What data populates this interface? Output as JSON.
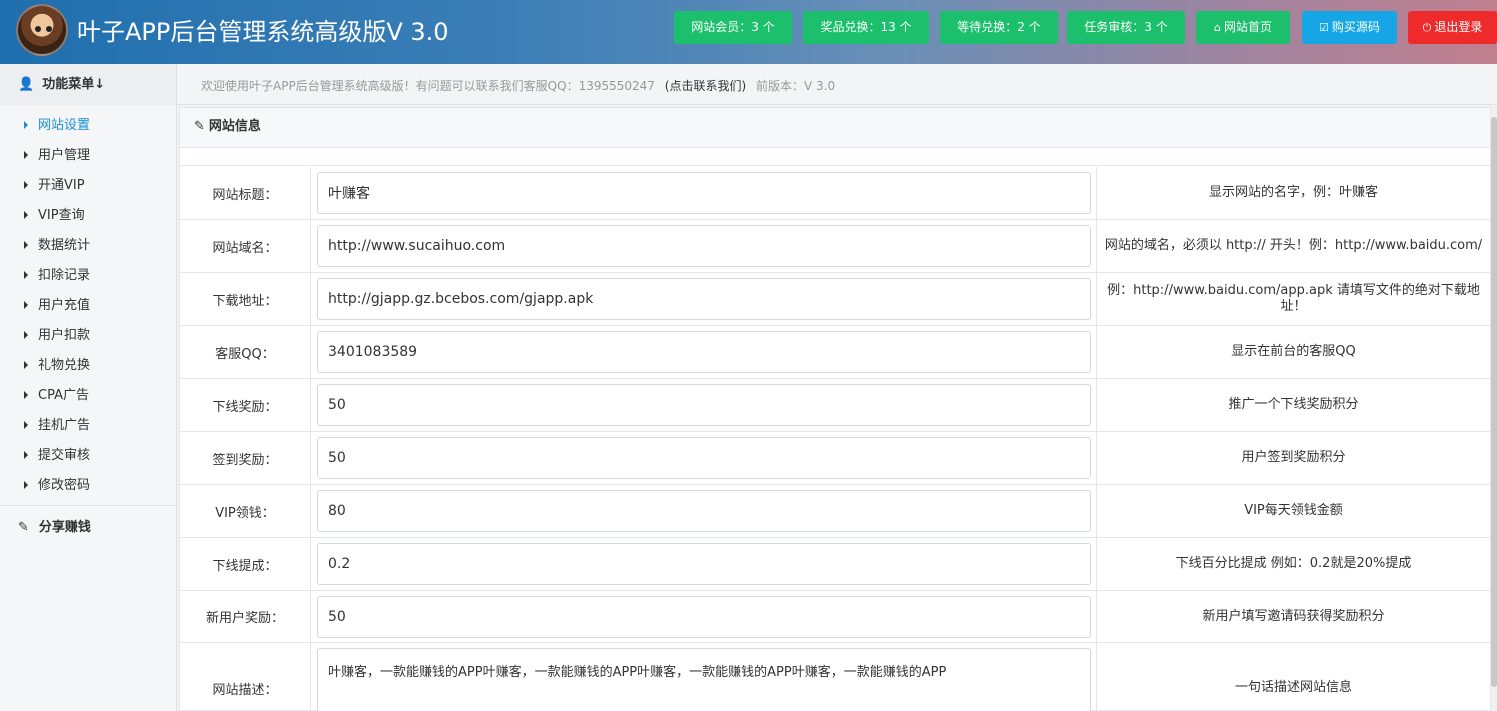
{
  "header": {
    "title": "叶子APP后台管理系统高级版V 3.0",
    "stats": [
      {
        "label": "网站会员：3 个"
      },
      {
        "label": "奖品兑换：13 个"
      },
      {
        "label": "等待兑换：2 个"
      },
      {
        "label": "任务审核：3 个"
      }
    ],
    "home_label": "网站首页",
    "buy_label": "购买源码",
    "logout_label": "退出登录",
    "colors": {
      "green": "#1cbf6b",
      "blue": "#16a6e6",
      "red": "#ee2a2a"
    }
  },
  "subbar": {
    "menu_title": "功能菜单↓",
    "welcome_prefix": "欢迎使用叶子APP后台管理系统高级版！有问题可以联系我们客服QQ：1395550247",
    "contact_label": "(点击联系我们)",
    "version": "前版本：V 3.0"
  },
  "sidebar": {
    "items": [
      {
        "label": "网站设置"
      },
      {
        "label": "用户管理"
      },
      {
        "label": "开通VIP"
      },
      {
        "label": "VIP查询"
      },
      {
        "label": "数据统计"
      },
      {
        "label": "扣除记录"
      },
      {
        "label": "用户充值"
      },
      {
        "label": "用户扣款"
      },
      {
        "label": "礼物兑换"
      },
      {
        "label": "CPA广告"
      },
      {
        "label": "挂机广告"
      },
      {
        "label": "提交审核"
      },
      {
        "label": "修改密码"
      }
    ],
    "share_label": "分享赚钱",
    "active_color": "#1a8fd0"
  },
  "panel": {
    "title": "网站信息",
    "rows": [
      {
        "label": "网站标题：",
        "value": "叶赚客",
        "hint": "显示网站的名字，例：叶赚客"
      },
      {
        "label": "网站域名：",
        "value": "http://www.sucaihuo.com",
        "hint": "网站的域名，必须以 http:// 开头！例：http://www.baidu.com/"
      },
      {
        "label": "下载地址：",
        "value": "http://gjapp.gz.bcebos.com/gjapp.apk",
        "hint": "例：http://www.baidu.com/app.apk 请填写文件的绝对下载地址！"
      },
      {
        "label": "客服QQ：",
        "value": "3401083589",
        "hint": "显示在前台的客服QQ"
      },
      {
        "label": "下线奖励：",
        "value": "50",
        "hint": "推广一个下线奖励积分"
      },
      {
        "label": "签到奖励：",
        "value": "50",
        "hint": "用户签到奖励积分"
      },
      {
        "label": "VIP领钱：",
        "value": "80",
        "hint": "VIP每天领钱金额"
      },
      {
        "label": "下线提成：",
        "value": "0.2",
        "hint": "下线百分比提成 例如：0.2就是20%提成"
      },
      {
        "label": "新用户奖励：",
        "value": "50",
        "hint": "新用户填写邀请码获得奖励积分"
      },
      {
        "label": "网站描述：",
        "value": "叶赚客，一款能赚钱的APP叶赚客，一款能赚钱的APP叶赚客，一款能赚钱的APP叶赚客，一款能赚钱的APP",
        "hint": "一句话描述网站信息"
      }
    ]
  }
}
